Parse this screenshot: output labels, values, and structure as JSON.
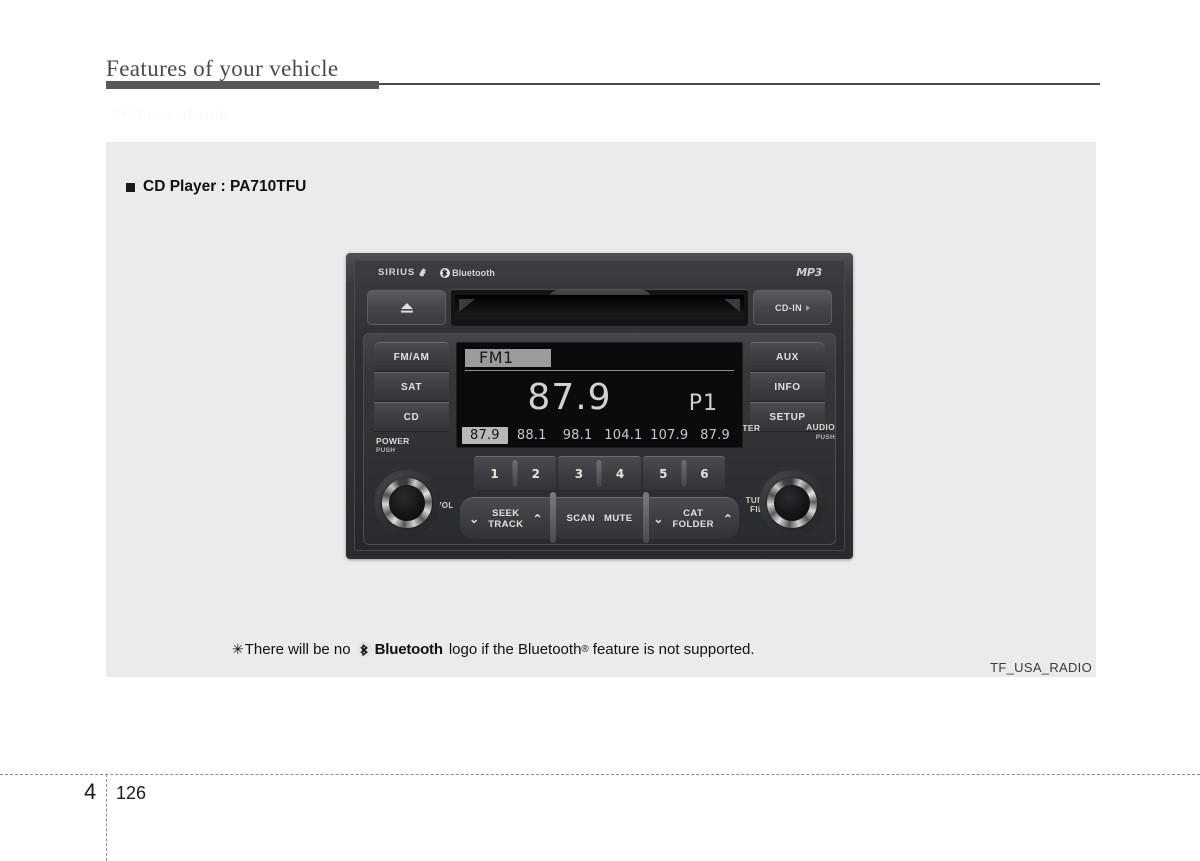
{
  "page": {
    "header_title": "Features of your vehicle",
    "ghost_text": "Features of your",
    "chapter_number": "4",
    "page_number": "126",
    "figure_id": "TF_USA_RADIO"
  },
  "section": {
    "heading": "CD Player : PA710TFU"
  },
  "caption": {
    "star": "✳",
    "before": "There will be no",
    "bluetooth_wordmark": "Bluetooth",
    "middle": "logo if the Bluetooth",
    "registered": "®",
    "after": "feature is not supported."
  },
  "radio": {
    "brand_sirius": "SIRIUS",
    "brand_bluetooth": "Bluetooth",
    "brand_mp3": "MP3",
    "eject_label": "eject",
    "cd_in_label": "CD-IN",
    "left_buttons": [
      {
        "label": "FM/AM"
      },
      {
        "label": "SAT"
      },
      {
        "label": "CD"
      }
    ],
    "right_buttons": [
      {
        "label": "AUX"
      },
      {
        "label": "INFO"
      },
      {
        "label": "SETUP"
      }
    ],
    "power_knob": {
      "label": "POWER",
      "sub": "PUSH"
    },
    "audio_knob": {
      "label": "AUDIO",
      "sub": "PUSH"
    },
    "enter_label": "ENTER",
    "vol_label": "VOL",
    "tune_label": "TUNE",
    "file_label": "FILE",
    "presets": [
      {
        "number": "1"
      },
      {
        "number": "2"
      },
      {
        "number": "3"
      },
      {
        "number": "4"
      },
      {
        "number": "5"
      },
      {
        "number": "6"
      }
    ],
    "controls": {
      "seek": "SEEK",
      "track": "TRACK",
      "scan": "SCAN",
      "mute": "MUTE",
      "cat": "CAT",
      "folder": "FOLDER",
      "chevron_down": "⌄",
      "chevron_up": "⌃"
    },
    "display": {
      "band": "FM1",
      "frequency": "87.9",
      "preset_indicator": "P1",
      "preset_list": [
        {
          "value": "87.9",
          "active": true
        },
        {
          "value": "88.1",
          "active": false
        },
        {
          "value": "98.1",
          "active": false
        },
        {
          "value": "104.1",
          "active": false
        },
        {
          "value": "107.9",
          "active": false
        },
        {
          "value": "87.9",
          "active": false
        }
      ]
    }
  },
  "colors": {
    "panel_bg": "#ebebeb",
    "header_rule": "#4c4c4c",
    "header_rule_accent": "#58585a",
    "screen_bg": "#0b0b0d",
    "screen_text": "#d2d2d2",
    "unit_body": "#2e2f32"
  }
}
